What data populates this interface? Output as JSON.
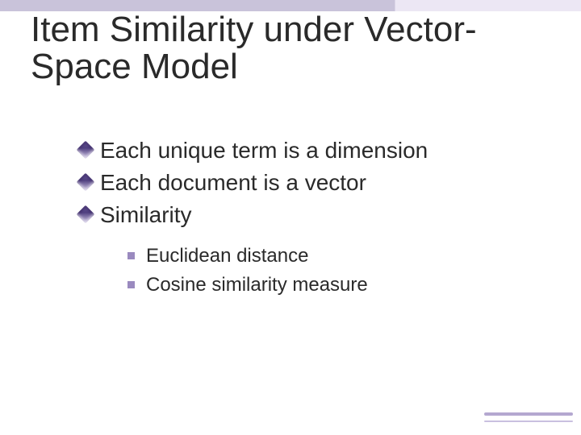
{
  "slide": {
    "title_line1": "Item Similarity under Vector-",
    "title_line2": "Space Model",
    "bullets": [
      {
        "text": "Each unique term is a dimension"
      },
      {
        "text": "Each document is a vector"
      },
      {
        "text": "Similarity"
      }
    ],
    "sub_bullets": [
      {
        "text": "Euclidean distance"
      },
      {
        "text": "Cosine similarity measure"
      }
    ]
  }
}
